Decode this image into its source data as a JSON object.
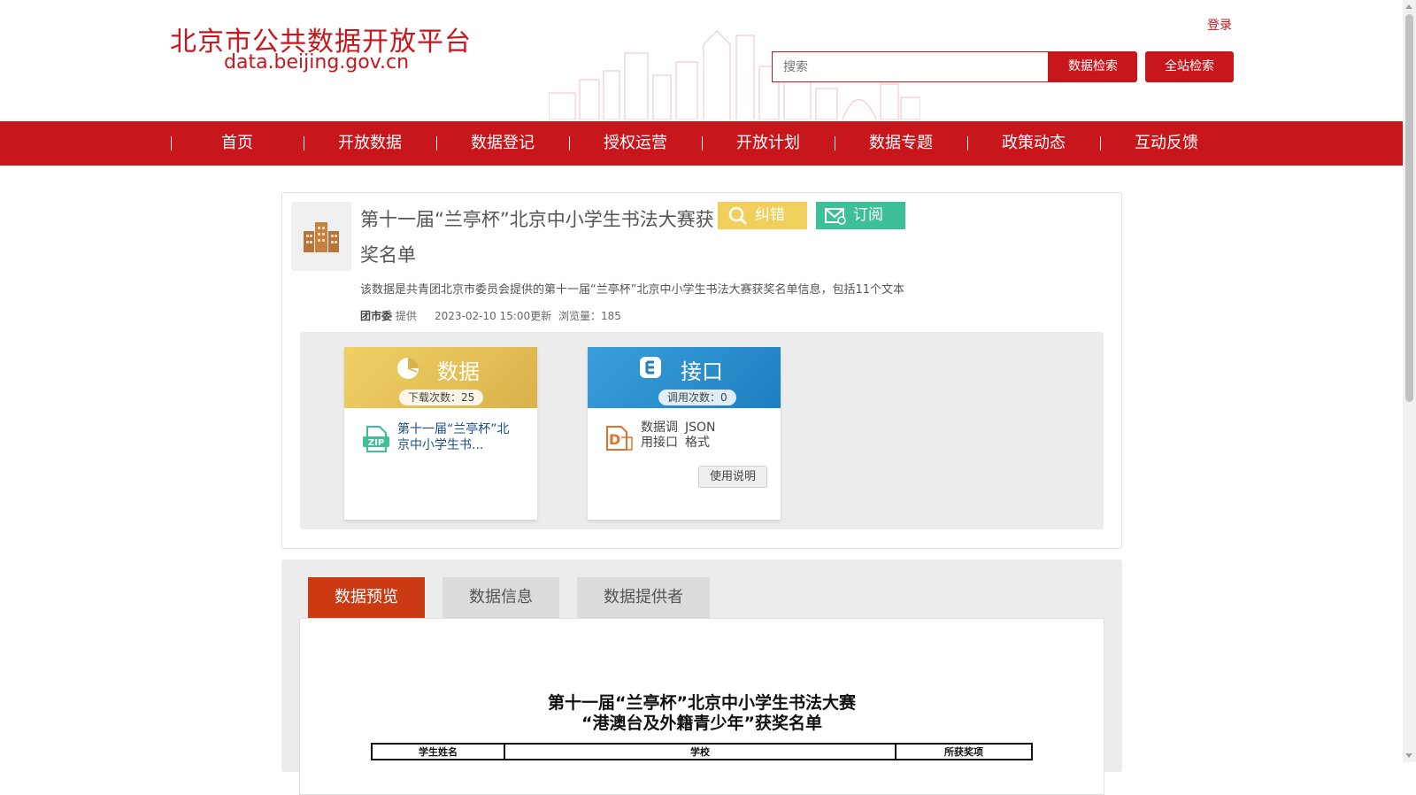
{
  "header": {
    "logo_cn": "北京市公共数据开放平台",
    "logo_en": "data.beijing.gov.cn",
    "login_label": "登录",
    "search_placeholder": "搜索",
    "data_search_label": "数据检索",
    "site_search_label": "全站检索"
  },
  "nav": {
    "items": [
      "首页",
      "开放数据",
      "数据登记",
      "授权运营",
      "开放计划",
      "数据专题",
      "政策动态",
      "互动反馈"
    ]
  },
  "dataset": {
    "title": "第十一届“兰亭杯”北京中小学生书法大赛获奖名单",
    "correction_label": "纠错",
    "subscribe_label": "订阅",
    "description": "该数据是共青团北京市委员会提供的第十一届“兰亭杯”北京中小学生书法大赛获奖名单信息，包括11个文本",
    "provider": "团市委",
    "provider_suffix": "提供",
    "updated": "2023-02-10 15:00更新",
    "views": "浏览量：185",
    "colors": {
      "accent": "#c8161d",
      "correction": "#f1cf5b",
      "subscribe": "#3dbf98"
    }
  },
  "data_panel": {
    "title": "数据",
    "downloads": "下载次数：25",
    "file_name": "第十一届“兰亭杯”北京中小学生书...",
    "icon": "zip-file-icon"
  },
  "api_panel": {
    "title": "接口",
    "calls": "调用次数：0",
    "label_line1": "数据调",
    "label_line2": "用接口",
    "format_line1": "JSON",
    "format_line2": "格式",
    "usage_label": "使用说明"
  },
  "tabs": {
    "items": [
      "数据预览",
      "数据信息",
      "数据提供者"
    ],
    "active": "数据预览"
  },
  "preview": {
    "title_line1": "第十一届“兰亭杯”北京中小学生书法大赛",
    "title_line2": "“港澳台及外籍青少年”获奖名单",
    "columns": [
      "学生姓名",
      "学校",
      "所获奖项"
    ]
  }
}
